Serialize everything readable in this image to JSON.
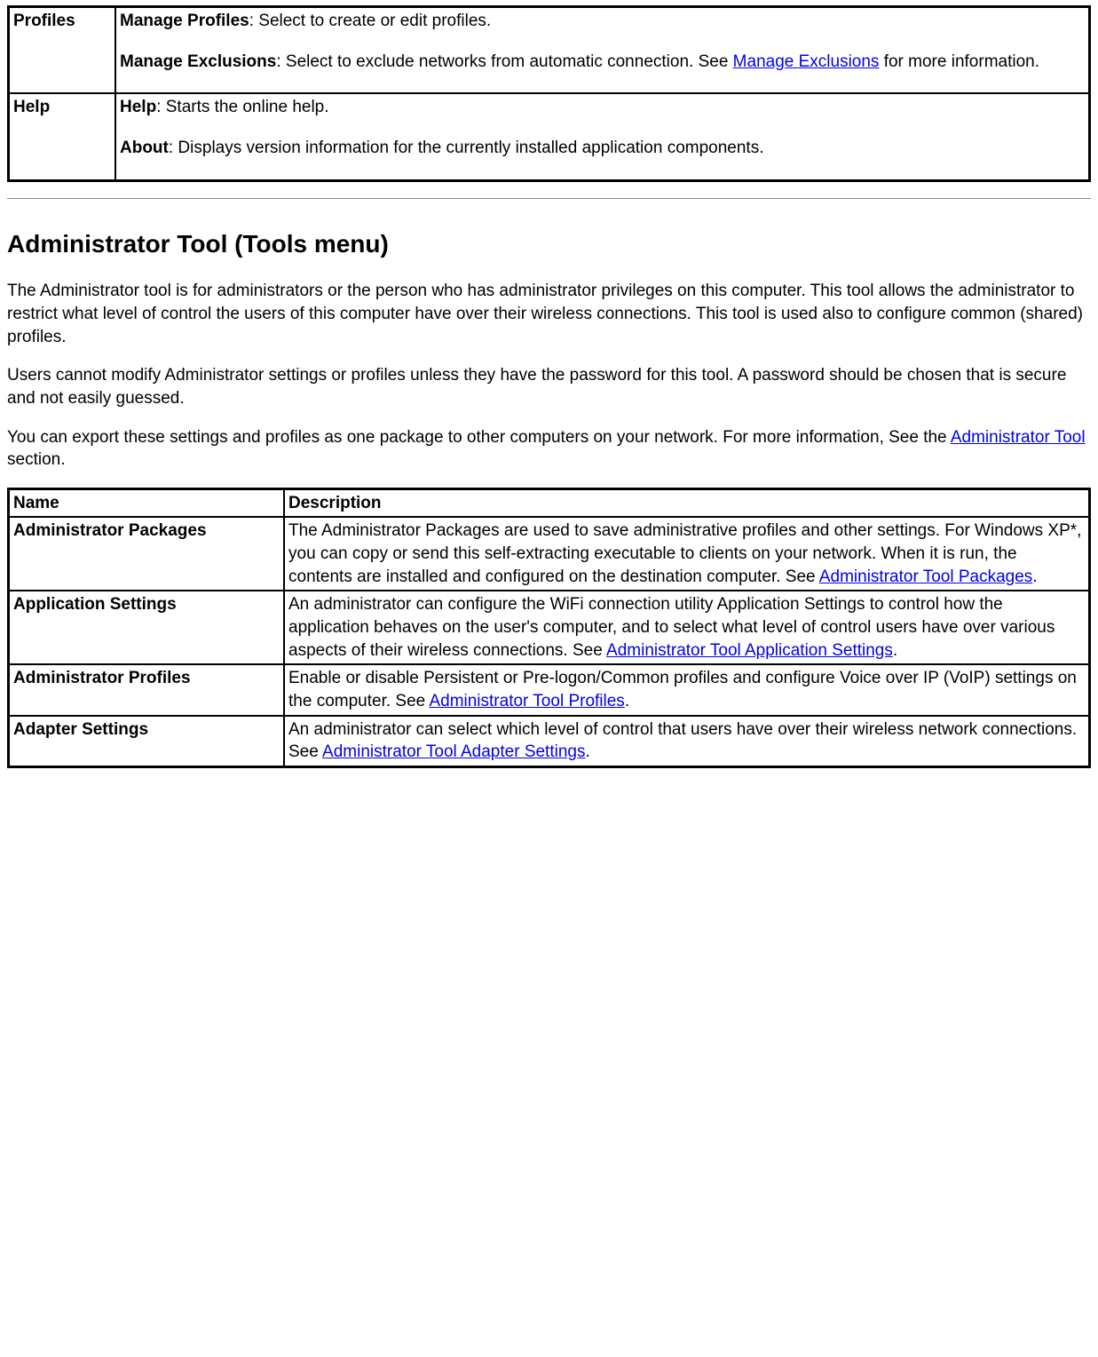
{
  "menuTable": {
    "rows": [
      {
        "label": "Profiles",
        "items": [
          {
            "term": "Manage Profiles",
            "text": ": Select to create or edit profiles."
          },
          {
            "term": "Manage Exclusions",
            "text": ": Select to exclude networks from automatic connection. See ",
            "link": "Manage Exclusions",
            "after": " for more information."
          }
        ]
      },
      {
        "label": "Help",
        "items": [
          {
            "term": "Help",
            "text": ": Starts the online help."
          },
          {
            "term": "About",
            "text": ": Displays version information for the currently installed application components."
          }
        ]
      }
    ]
  },
  "heading": "Administrator Tool (Tools menu)",
  "intro1": "The Administrator tool is for administrators or the person who has administrator privileges on this computer. This tool allows the administrator to restrict what level of control the users of this computer have over their wireless connections. This tool is used also to configure common (shared) profiles.",
  "intro2": "Users cannot modify Administrator settings or profiles unless they have the password for this tool. A password should be chosen that is secure and not easily guessed.",
  "intro3a": "You can export these settings and profiles as one package to other computers on your network. For more information, See the ",
  "intro3link": "Administrator Tool",
  "intro3b": " section.",
  "adminTable": {
    "headers": {
      "name": "Name",
      "desc": "Description"
    },
    "rows": [
      {
        "name": "Administrator Packages",
        "desc": "The Administrator Packages are used to save administrative profiles and other settings. For Windows XP*, you can copy or send this self-extracting executable to clients on your network. When it is run, the contents are installed and configured on the destination computer. See ",
        "link": "Administrator Tool Packages",
        "after": "."
      },
      {
        "name": "Application Settings",
        "desc": "An administrator can configure the WiFi connection utility Application Settings to control how the application behaves on the user's computer, and to select what level of control users have over various aspects of their wireless connections. See ",
        "link": "Administrator Tool Application Settings",
        "after": "."
      },
      {
        "name": "Administrator Profiles",
        "desc": "Enable or disable Persistent or Pre-logon/Common profiles and configure Voice over IP (VoIP) settings on the computer. See ",
        "link": "Administrator Tool Profiles",
        "after": "."
      },
      {
        "name": "Adapter Settings",
        "desc": "An administrator can select which level of control that users have over their wireless network connections. See ",
        "link": "Administrator Tool Adapter Settings",
        "after": "."
      }
    ]
  }
}
